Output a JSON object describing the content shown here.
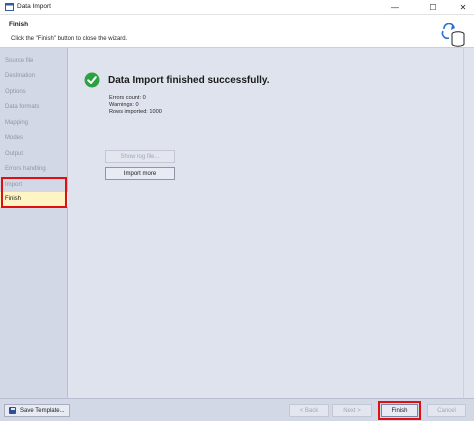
{
  "window": {
    "title": "Data Import",
    "controls": {
      "minimize": "—",
      "maximize": "☐",
      "close": "✕"
    }
  },
  "header": {
    "title": "Finish",
    "subtitle": "Click the \"Finish\" button to close the wizard.",
    "icon": "database-export-icon"
  },
  "sidebar": {
    "items": [
      {
        "label": "Source file",
        "state": "done"
      },
      {
        "label": "Destination",
        "state": "done"
      },
      {
        "label": "Options",
        "state": "done"
      },
      {
        "label": "Data formats",
        "state": "done"
      },
      {
        "label": "Mapping",
        "state": "done"
      },
      {
        "label": "Modes",
        "state": "done"
      },
      {
        "label": "Output",
        "state": "done"
      },
      {
        "label": "Errors handling",
        "state": "done"
      },
      {
        "label": "Import",
        "state": "done"
      },
      {
        "label": "Finish",
        "state": "current"
      }
    ]
  },
  "main": {
    "status_icon": "check-circle-icon",
    "title": "Data Import finished successfully.",
    "stats": [
      "Errors count: 0",
      "Warnings: 0",
      "Rows imported: 1000"
    ],
    "show_log_label": "Show log file...",
    "import_more_label": "Import more"
  },
  "footer": {
    "save_template_label": "Save Template...",
    "back_label": "< Back",
    "next_label": "Next >",
    "finish_label": "Finish",
    "cancel_label": "Cancel"
  },
  "colors": {
    "sidebar_bg": "#d3d8e6",
    "content_bg": "#dfe3ee",
    "current_step_bg": "#fff4c4",
    "success_green": "#2ea043",
    "highlight_red": "#e01010"
  }
}
